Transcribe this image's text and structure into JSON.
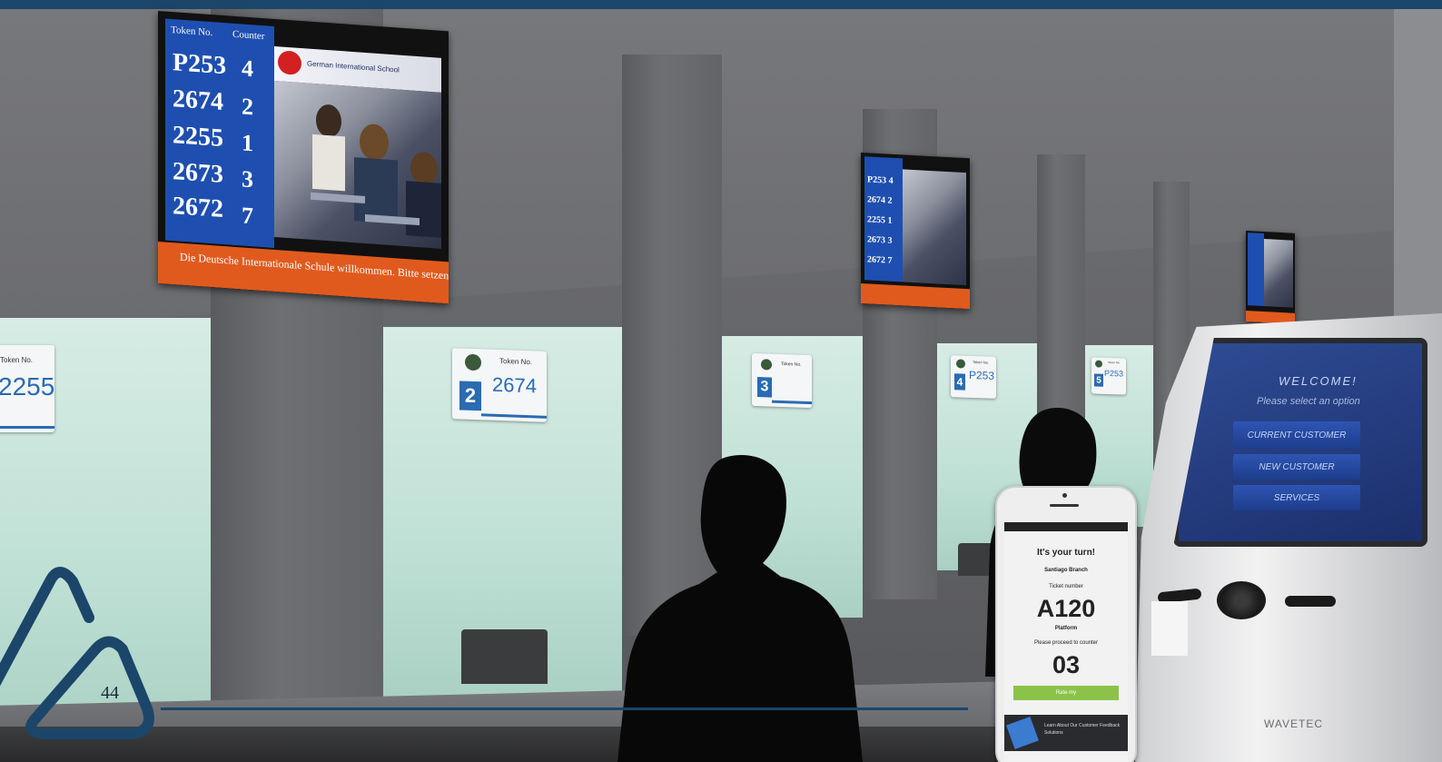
{
  "colors": {
    "brand_blue": "#1b466a",
    "display_blue": "#1e4fb0",
    "banner_orange": "#e15a1d",
    "glass_green": "#c6e4da",
    "phone_green": "#8bc34a"
  },
  "page": {
    "number": "44"
  },
  "displays": {
    "main": {
      "header_token": "Token No.",
      "header_counter": "Counter",
      "school_name": "German International School",
      "rows": [
        {
          "token": "P253",
          "counter": "4"
        },
        {
          "token": "2674",
          "counter": "2"
        },
        {
          "token": "2255",
          "counter": "1"
        },
        {
          "token": "2673",
          "counter": "3"
        },
        {
          "token": "2672",
          "counter": "7"
        }
      ],
      "banner": "Die Deutsche Internationale Schule willkommen. Bitte setzen Sie"
    },
    "mid": {
      "rows": [
        {
          "token": "P253",
          "counter": "4"
        },
        {
          "token": "2674",
          "counter": "2"
        },
        {
          "token": "2255",
          "counter": "1"
        },
        {
          "token": "2673",
          "counter": "3"
        },
        {
          "token": "2672",
          "counter": "7"
        }
      ]
    }
  },
  "counter_signs": [
    {
      "label": "Token No.",
      "counter": "",
      "token": "2255"
    },
    {
      "label": "Token No.",
      "counter": "2",
      "token": "2674"
    },
    {
      "label": "Token No.",
      "counter": "3",
      "token": ""
    },
    {
      "label": "Token No.",
      "counter": "4",
      "token": "P253"
    },
    {
      "label": "Token No.",
      "counter": "5",
      "token": "P253"
    }
  ],
  "kiosk": {
    "welcome": "WELCOME!",
    "prompt": "Please select an option",
    "options": [
      "CURRENT CUSTOMER",
      "NEW CUSTOMER",
      "SERVICES"
    ],
    "brand": "WAVETEC"
  },
  "phone": {
    "title": "It's your turn!",
    "branch": "Santiago Branch",
    "ticket_label": "Ticket number",
    "ticket": "A120",
    "platform_label": "Platform",
    "proceed_label": "Please proceed to counter",
    "counter": "03",
    "button": "Rate my",
    "footer": "Learn About Our Customer Feedback Solutions"
  }
}
